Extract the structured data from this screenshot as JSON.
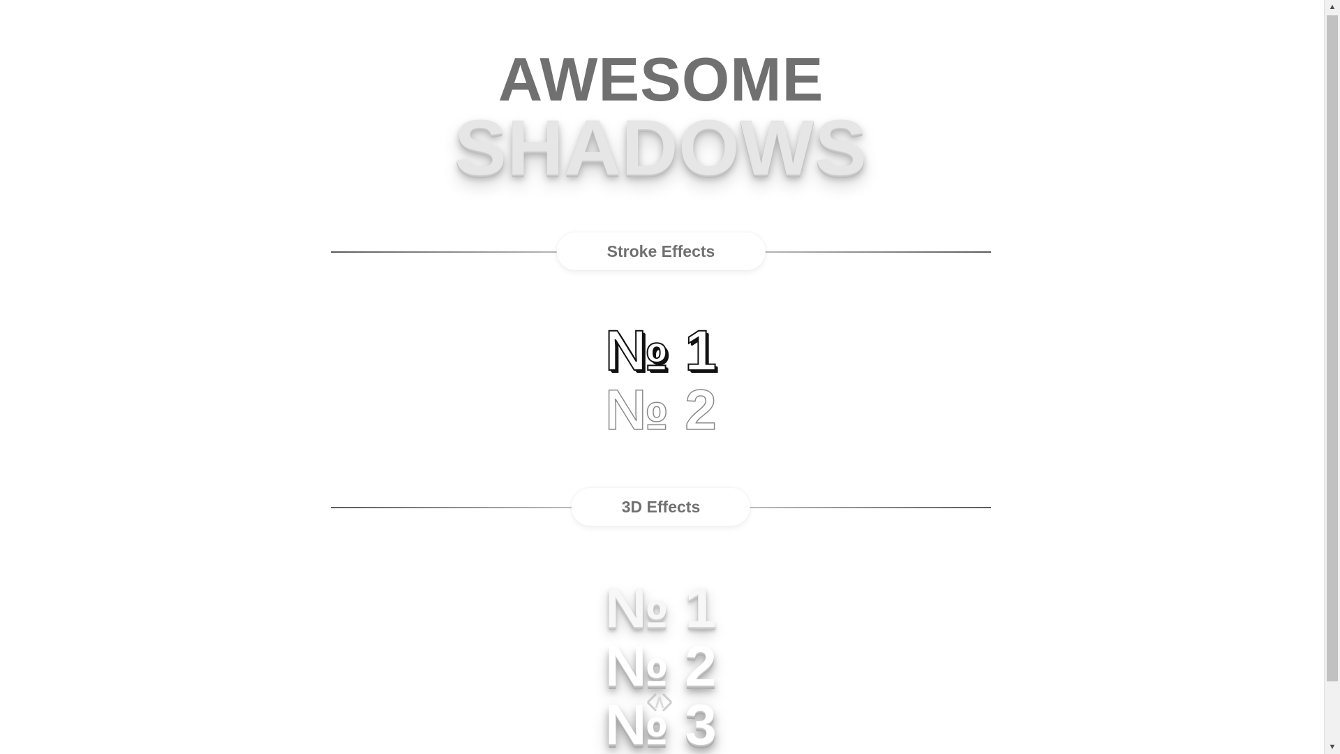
{
  "hero": {
    "line1": "AWESOME",
    "line2": "SHADOWS"
  },
  "sections": {
    "stroke": {
      "title": "Stroke Effects",
      "samples": [
        "№ 1",
        "№ 2"
      ]
    },
    "three_d": {
      "title": "3D Effects",
      "samples": [
        "№ 1",
        "№ 2",
        "№ 3"
      ]
    }
  },
  "overlay": {
    "scroll_chip_icon": "chevron-up-icon",
    "scroll_chip_glyph": "‹^›"
  },
  "scrollbar": {
    "up_glyph": "▲",
    "down_glyph": "▼"
  },
  "colors": {
    "title_dark": "#707070",
    "title_light": "#e6e6e6",
    "background": "#ffffff"
  }
}
